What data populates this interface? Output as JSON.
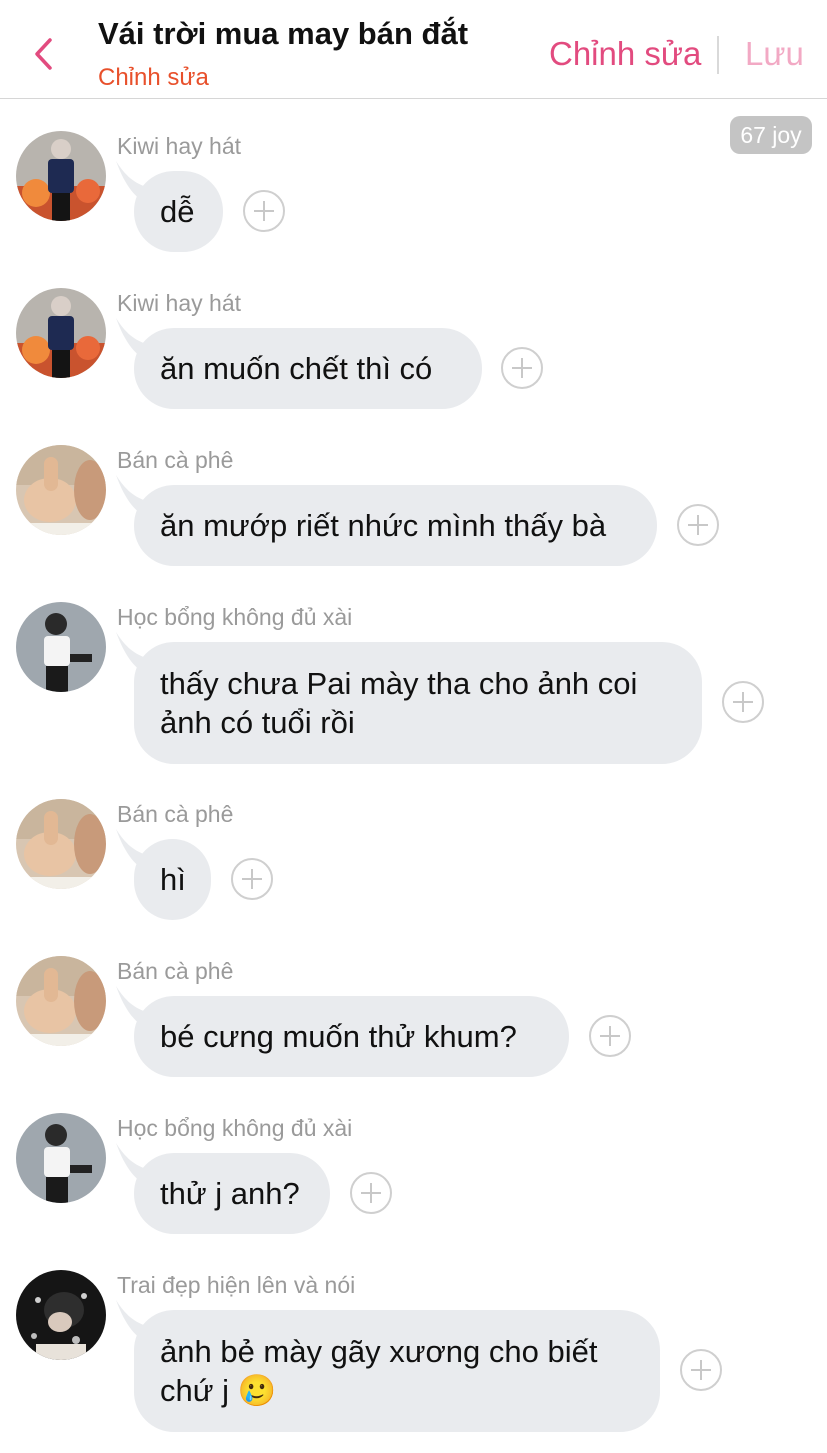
{
  "header": {
    "title": "Vái trời mua may bán đắt",
    "subtitle": "Chỉnh sửa",
    "edit_label": "Chỉnh sửa",
    "save_label": "Lưu"
  },
  "joy_badge": "67 joy",
  "messages": [
    {
      "sender": "Kiwi hay hát",
      "avatar": "avatar-jacket-man",
      "lines": [
        "dễ"
      ]
    },
    {
      "sender": "Kiwi hay hát",
      "avatar": "avatar-jacket-man",
      "lines": [
        "ăn muốn chết thì có"
      ]
    },
    {
      "sender": "Bán cà phê",
      "avatar": "avatar-thumbs-up",
      "lines": [
        "ăn mướp riết nhức mình thấy bà"
      ]
    },
    {
      "sender": "Học bổng không đủ xài",
      "avatar": "avatar-white-shirt",
      "lines": [
        "thấy chưa Pai mày tha cho ảnh coi",
        "ảnh có tuổi rồi"
      ]
    },
    {
      "sender": "Bán cà phê",
      "avatar": "avatar-thumbs-up",
      "lines": [
        "hì"
      ]
    },
    {
      "sender": "Bán cà phê",
      "avatar": "avatar-thumbs-up",
      "lines": [
        "bé cưng muốn thử khum?"
      ]
    },
    {
      "sender": "Học bổng không đủ xài",
      "avatar": "avatar-white-shirt",
      "lines": [
        "thử j anh?"
      ]
    },
    {
      "sender": "Trai đẹp hiện lên và nói",
      "avatar": "avatar-dark-portrait",
      "lines": [
        "ảnh bẻ mày gãy xương cho biết",
        "chứ j 🥲"
      ]
    }
  ],
  "colors": {
    "accent": "#e24b7f",
    "subtitle": "#e8502b",
    "save_disabled": "#f2a9c4",
    "bubble": "#e9ebee",
    "sender": "#9a9a9a"
  }
}
